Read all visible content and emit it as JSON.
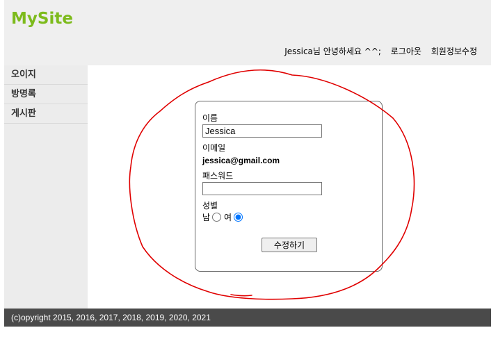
{
  "header": {
    "logo": "MySite",
    "greeting": "Jessica님 안녕하세요 ^^;",
    "logout": "로그아웃",
    "edit_profile": "회원정보수정"
  },
  "sidebar": {
    "items": [
      {
        "label": "오이지"
      },
      {
        "label": "방명록"
      },
      {
        "label": "게시판"
      }
    ]
  },
  "form": {
    "name_label": "이름",
    "name_value": "Jessica",
    "email_label": "이메일",
    "email_value": "jessica@gmail.com",
    "password_label": "패스워드",
    "password_value": "",
    "gender_label": "성별",
    "gender_male": "남",
    "gender_female": "여",
    "selected_gender": "female",
    "submit_label": "수정하기"
  },
  "footer": {
    "copyright": "(c)opyright 2015, 2016, 2017, 2018, 2019, 2020, 2021"
  },
  "colors": {
    "logo": "#7dbb1c",
    "header_bg": "#efefef",
    "sidebar_bg": "#ececec",
    "footer_bg": "#4a4a4a",
    "annotation": "#e00000"
  }
}
